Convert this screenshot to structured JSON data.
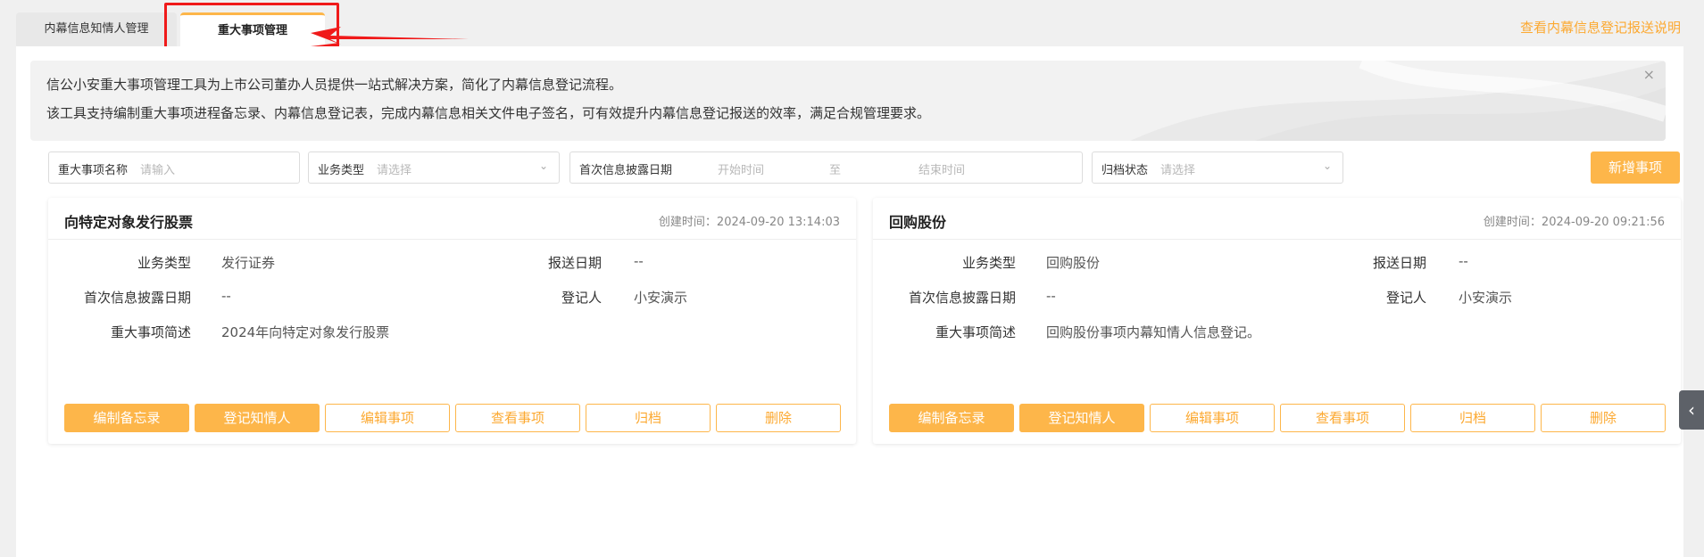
{
  "tabs": [
    {
      "label": "内幕信息知情人管理"
    },
    {
      "label": "重大事项管理"
    }
  ],
  "help_link": "查看内幕信息登记报送说明",
  "notice": {
    "line1": "信公小安重大事项管理工具为上市公司董办人员提供一站式解决方案，简化了内幕信息登记流程。",
    "line2": "该工具支持编制重大事项进程备忘录、内幕信息登记表，完成内幕信息相关文件电子签名，可有效提升内幕信息登记报送的效率，满足合规管理要求。",
    "close_icon": "×"
  },
  "filters": {
    "name_label": "重大事项名称",
    "name_placeholder": "请输入",
    "type_label": "业务类型",
    "type_placeholder": "请选择",
    "date_label": "首次信息披露日期",
    "date_start": "开始时间",
    "date_sep": "至",
    "date_end": "结束时间",
    "status_label": "归档状态",
    "status_placeholder": "请选择"
  },
  "add_button": "新增事项",
  "field_labels": {
    "biz_type": "业务类型",
    "report_date": "报送日期",
    "first_disclosure": "首次信息披露日期",
    "registrar": "登记人",
    "summary": "重大事项简述"
  },
  "cards": [
    {
      "title": "向特定对象发行股票",
      "created": "创建时间：2024-09-20 13:14:03",
      "biz_type": "发行证券",
      "report_date": "--",
      "first_disclosure": "--",
      "registrar": "小安演示",
      "summary": "2024年向特定对象发行股票"
    },
    {
      "title": "回购股份",
      "created": "创建时间：2024-09-20 09:21:56",
      "biz_type": "回购股份",
      "report_date": "--",
      "first_disclosure": "--",
      "registrar": "小安演示",
      "summary": "回购股份事项内幕知情人信息登记。"
    }
  ],
  "card_buttons": [
    "编制备忘录",
    "登记知情人",
    "编辑事项",
    "查看事项",
    "归档",
    "删除"
  ],
  "colors": {
    "accent": "#fdb64a",
    "annotation": "#f01a1a",
    "link": "#fca931"
  },
  "icons": {
    "chevron": "chevron-down-icon",
    "side_toggle": "chevron-left-icon"
  }
}
